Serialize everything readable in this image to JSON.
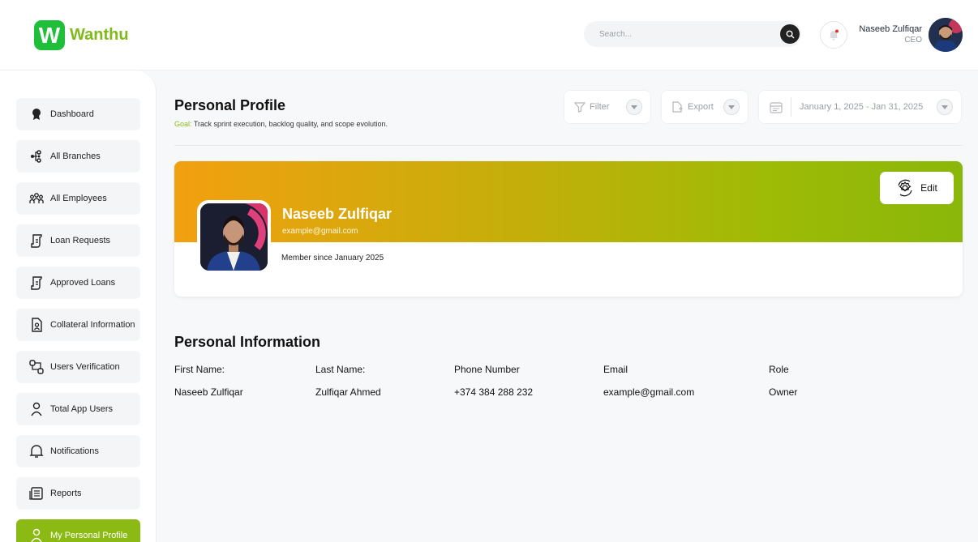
{
  "brand": {
    "logo_letter": "W",
    "name": "Wanthu",
    "accent": "#8cba14"
  },
  "header": {
    "search_placeholder": "Search...",
    "user_name": "Naseeb Zulfiqar",
    "user_role": "CEO"
  },
  "sidebar": {
    "items": [
      {
        "label": "Dashboard",
        "icon": "dashboard-icon",
        "active": false
      },
      {
        "label": "All Branches",
        "icon": "branches-icon",
        "active": false
      },
      {
        "label": "All Employees",
        "icon": "employees-icon",
        "active": false
      },
      {
        "label": "Loan Requests",
        "icon": "loan-requests-icon",
        "active": false
      },
      {
        "label": "Approved Loans",
        "icon": "approved-loans-icon",
        "active": false
      },
      {
        "label": "Collateral Information",
        "icon": "collateral-icon",
        "active": false
      },
      {
        "label": "Users Verification",
        "icon": "users-verification-icon",
        "active": false
      },
      {
        "label": "Total App Users",
        "icon": "user-icon",
        "active": false
      },
      {
        "label": "Notifications",
        "icon": "bell-icon",
        "active": false
      },
      {
        "label": "Reports",
        "icon": "reports-icon",
        "active": false
      },
      {
        "label": "My Personal Profile",
        "icon": "profile-icon",
        "active": true
      }
    ]
  },
  "page": {
    "title": "Personal Profile",
    "goal_label": "Goal:",
    "goal_text": "Track sprint execution, backlog quality, and scope evolution."
  },
  "toolbar": {
    "filter_label": "Filter",
    "export_label": "Export",
    "date_range": "January 1, 2025 - Jan 31, 2025"
  },
  "profile": {
    "name": "Naseeb Zulfiqar",
    "email": "example@gmail.com",
    "member_since": "Member since January 2025",
    "edit_label": "Edit"
  },
  "personal_info": {
    "title": "Personal Information",
    "fields": [
      {
        "label": "First Name:",
        "value": "Naseeb Zulfiqar"
      },
      {
        "label": "Last Name:",
        "value": "Zulfiqar Ahmed"
      },
      {
        "label": "Phone Number",
        "value": "+374 384 288 232"
      },
      {
        "label": "Email",
        "value": "example@gmail.com"
      },
      {
        "label": "Role",
        "value": "Owner"
      }
    ]
  }
}
